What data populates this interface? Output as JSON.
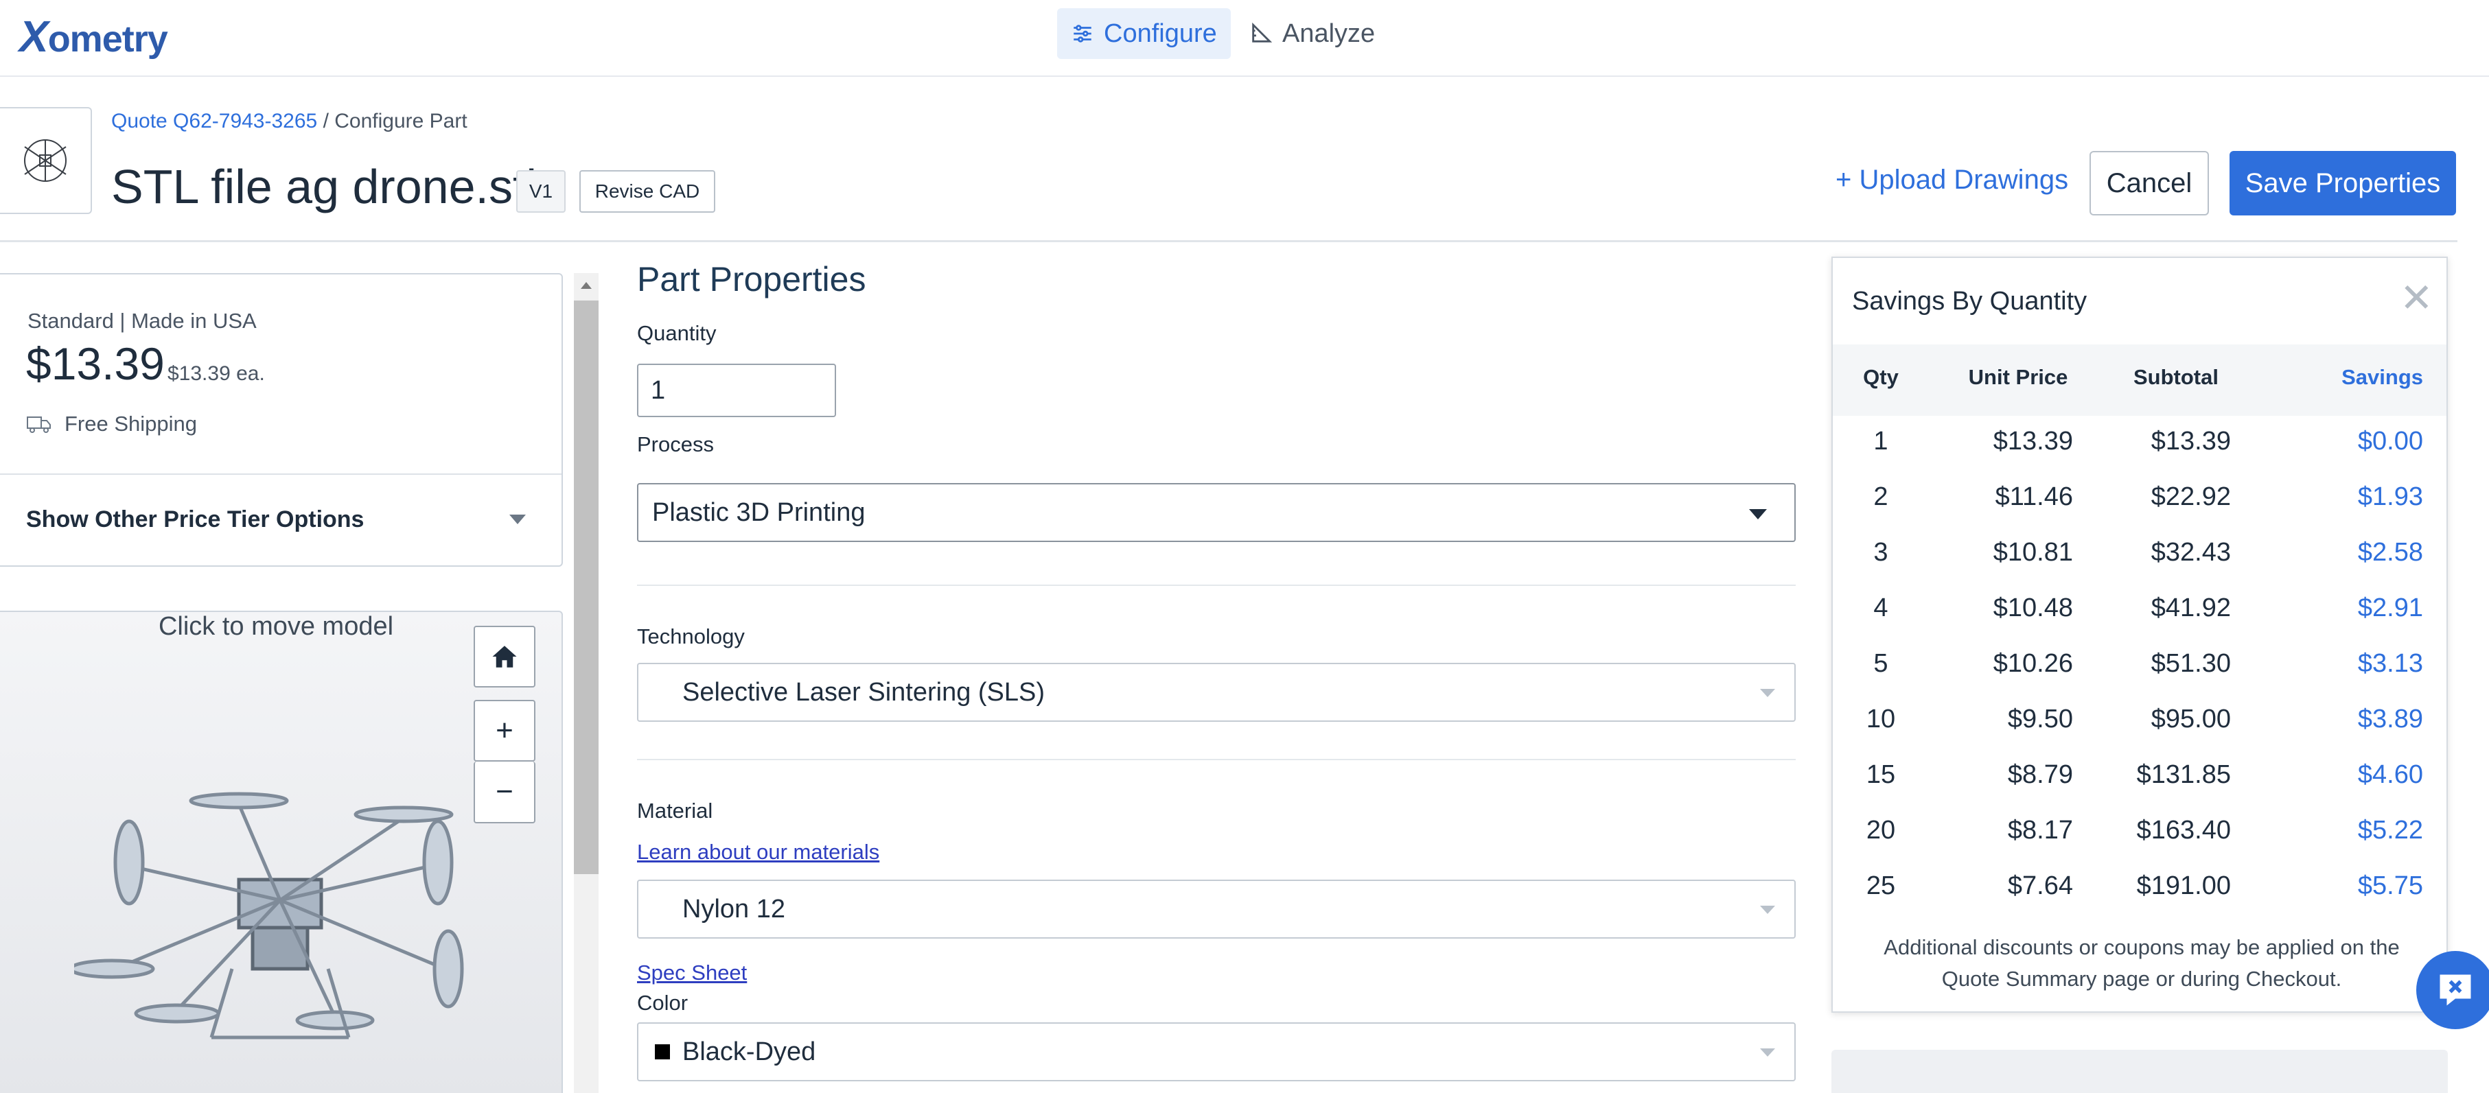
{
  "brand": {
    "logo_first": "X",
    "logo_rest": "ometry"
  },
  "nav": {
    "tabs": [
      {
        "label": "Configure",
        "active": true,
        "icon": "sliders-icon"
      },
      {
        "label": "Analyze",
        "active": false,
        "icon": "triangle-ruler-icon"
      }
    ]
  },
  "header": {
    "quote_link": "Quote Q62-7943-3265",
    "breadcrumb_sep": " / ",
    "breadcrumb_current": "Configure Part",
    "part_name": "STL file ag drone.stl",
    "version": "V1",
    "revise_label": "Revise CAD",
    "upload_label": "+ Upload Drawings",
    "cancel_label": "Cancel",
    "save_label": "Save Properties"
  },
  "pricing": {
    "tier": "Standard | Made in USA",
    "price": "$13.39",
    "each": "$13.39 ea.",
    "shipping": "Free Shipping",
    "tier_options_label": "Show Other Price Tier Options"
  },
  "viewer": {
    "hint": "Click to move model",
    "home_icon": "home-icon",
    "zoom_in": "+",
    "zoom_out": "−"
  },
  "form": {
    "title": "Part Properties",
    "quantity_label": "Quantity",
    "quantity_value": "1",
    "process_label": "Process",
    "process_value": "Plastic 3D Printing",
    "technology_label": "Technology",
    "technology_value": "Selective Laser Sintering (SLS)",
    "material_label": "Material",
    "materials_link": "Learn about our materials",
    "material_value": "Nylon 12",
    "spec_sheet_link": "Spec Sheet",
    "color_label": "Color",
    "color_value": "Black-Dyed"
  },
  "savings": {
    "title": "Savings By Quantity",
    "headers": {
      "qty": "Qty",
      "unit": "Unit Price",
      "subtotal": "Subtotal",
      "savings": "Savings"
    },
    "rows": [
      {
        "qty": "1",
        "unit": "$13.39",
        "subtotal": "$13.39",
        "savings": "$0.00"
      },
      {
        "qty": "2",
        "unit": "$11.46",
        "subtotal": "$22.92",
        "savings": "$1.93"
      },
      {
        "qty": "3",
        "unit": "$10.81",
        "subtotal": "$32.43",
        "savings": "$2.58"
      },
      {
        "qty": "4",
        "unit": "$10.48",
        "subtotal": "$41.92",
        "savings": "$2.91"
      },
      {
        "qty": "5",
        "unit": "$10.26",
        "subtotal": "$51.30",
        "savings": "$3.13"
      },
      {
        "qty": "10",
        "unit": "$9.50",
        "subtotal": "$95.00",
        "savings": "$3.89"
      },
      {
        "qty": "15",
        "unit": "$8.79",
        "subtotal": "$131.85",
        "savings": "$4.60"
      },
      {
        "qty": "20",
        "unit": "$8.17",
        "subtotal": "$163.40",
        "savings": "$5.22"
      },
      {
        "qty": "25",
        "unit": "$7.64",
        "subtotal": "$191.00",
        "savings": "$5.75"
      }
    ],
    "note": "Additional discounts or coupons may be applied on the Quote Summary page or during Checkout."
  },
  "colors": {
    "accent": "#2e6fdc",
    "text": "#1f2d3d"
  }
}
